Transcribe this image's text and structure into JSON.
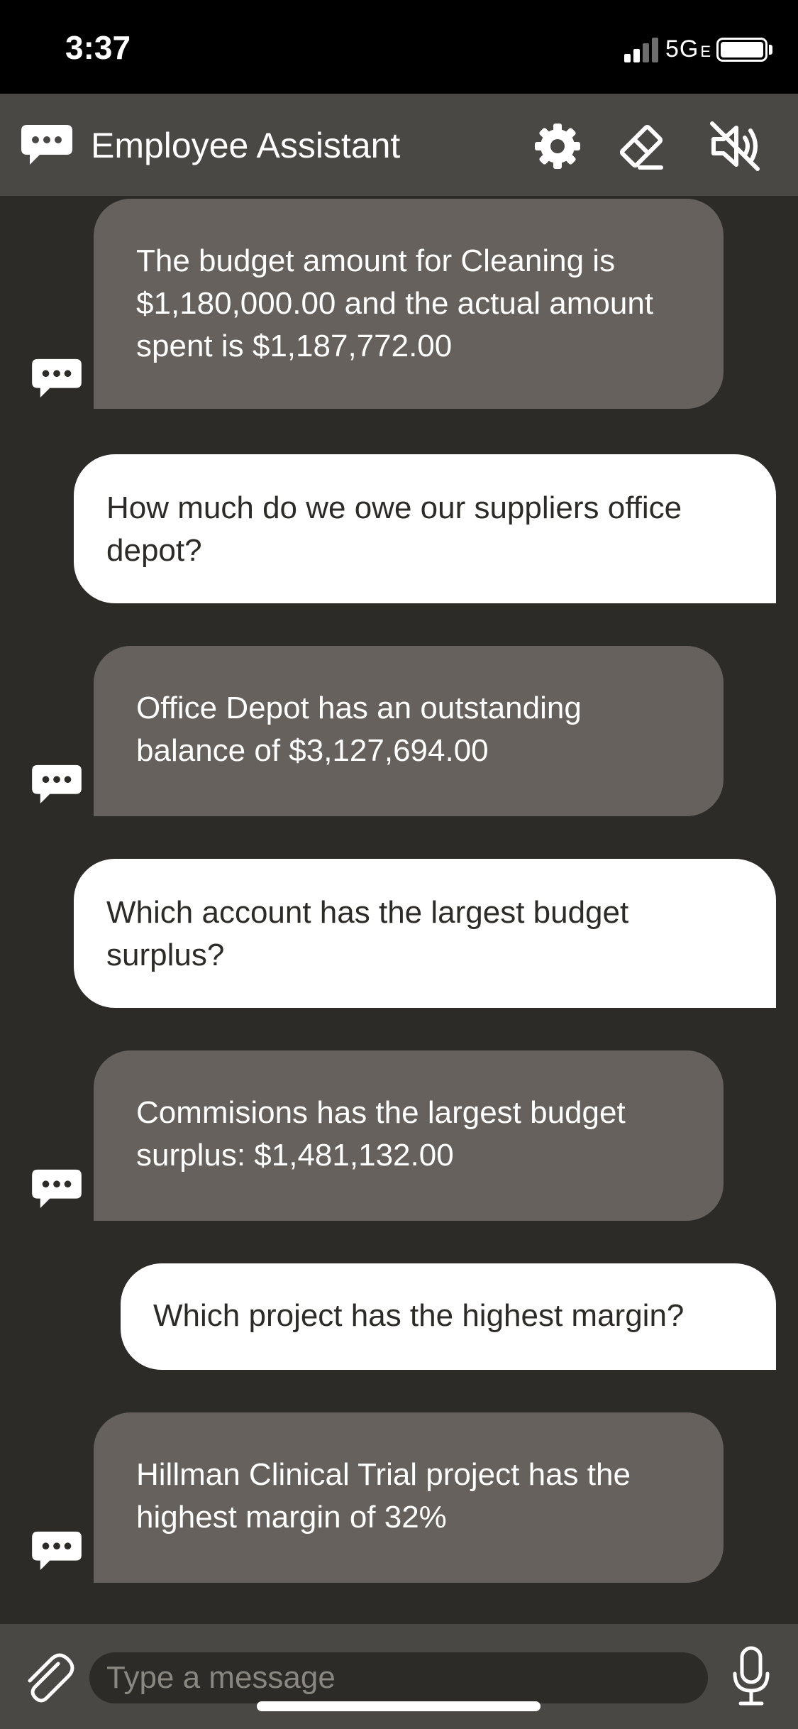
{
  "status_bar": {
    "time": "3:37",
    "network": "5G",
    "network_suffix": "E"
  },
  "header": {
    "title": "Employee Assistant",
    "icons": [
      "chat-bubble-icon",
      "gear-icon",
      "eraser-icon",
      "speaker-muted-icon"
    ]
  },
  "messages": [
    {
      "sender": "bot",
      "text": "The budget amount for Cleaning is $1,180,000.00 and the actual amount spent is $1,187,772.00"
    },
    {
      "sender": "user",
      "text": "How much do we owe our suppliers of­fice depot?"
    },
    {
      "sender": "bot",
      "text": "Office Depot has an outstanding balance of $3,127,694.00"
    },
    {
      "sender": "user",
      "text": "Which account has the largest budget surplus?"
    },
    {
      "sender": "bot",
      "text": "Commisions has the largest bud­get surplus:  $1,481,132.00"
    },
    {
      "sender": "user",
      "text": "Which project has the highest margin?"
    },
    {
      "sender": "bot",
      "text": "Hillman Clinical Trial project has the highest margin of 32%"
    }
  ],
  "composer": {
    "placeholder": "Type a message",
    "icons": [
      "paperclip-icon",
      "microphone-icon"
    ]
  },
  "colors": {
    "background": "#2c2b28",
    "header": "#4a4844",
    "bot_bubble": "#66615c",
    "user_bubble": "#ffffff"
  }
}
